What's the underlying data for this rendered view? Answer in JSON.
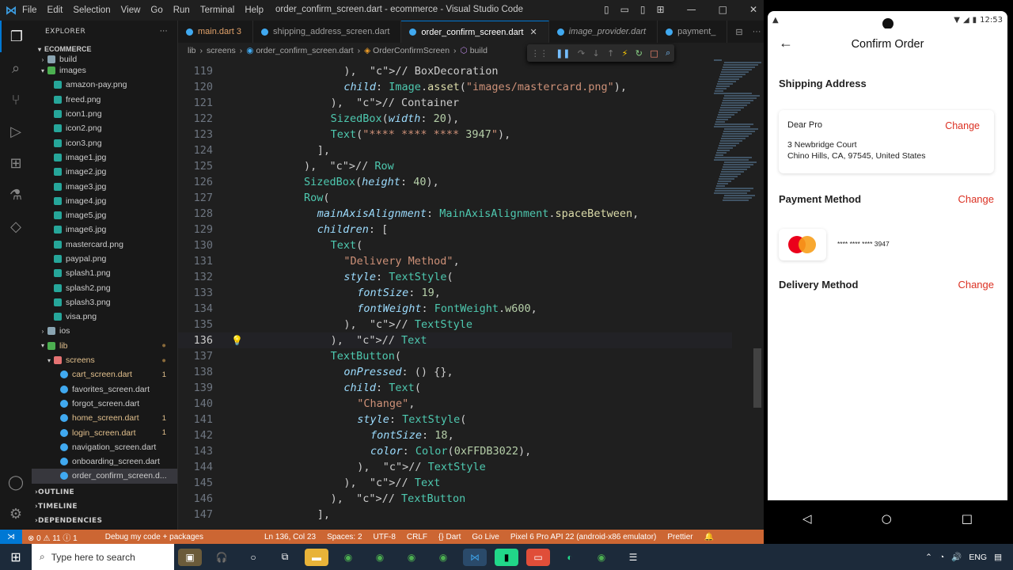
{
  "window": {
    "title": "order_confirm_screen.dart - ecommerce - Visual Studio Code",
    "menu": [
      "File",
      "Edit",
      "Selection",
      "View",
      "Go",
      "Run",
      "Terminal",
      "Help"
    ]
  },
  "sidebar": {
    "header": "EXPLORER",
    "project": "ECOMMERCE",
    "items": [
      {
        "label": "build",
        "type": "folder",
        "depth": 1
      },
      {
        "label": "images",
        "type": "folder-open",
        "depth": 1
      },
      {
        "label": "amazon-pay.png",
        "type": "img",
        "depth": 2
      },
      {
        "label": "freed.png",
        "type": "img",
        "depth": 2
      },
      {
        "label": "icon1.png",
        "type": "img",
        "depth": 2
      },
      {
        "label": "icon2.png",
        "type": "img",
        "depth": 2
      },
      {
        "label": "icon3.png",
        "type": "img",
        "depth": 2
      },
      {
        "label": "image1.jpg",
        "type": "img",
        "depth": 2
      },
      {
        "label": "image2.jpg",
        "type": "img",
        "depth": 2
      },
      {
        "label": "image3.jpg",
        "type": "img",
        "depth": 2
      },
      {
        "label": "image4.jpg",
        "type": "img",
        "depth": 2
      },
      {
        "label": "image5.jpg",
        "type": "img",
        "depth": 2
      },
      {
        "label": "image6.jpg",
        "type": "img",
        "depth": 2
      },
      {
        "label": "mastercard.png",
        "type": "img",
        "depth": 2
      },
      {
        "label": "paypal.png",
        "type": "img",
        "depth": 2
      },
      {
        "label": "splash1.png",
        "type": "img",
        "depth": 2
      },
      {
        "label": "splash2.png",
        "type": "img",
        "depth": 2
      },
      {
        "label": "splash3.png",
        "type": "img",
        "depth": 2
      },
      {
        "label": "visa.png",
        "type": "img",
        "depth": 2
      },
      {
        "label": "ios",
        "type": "folder",
        "depth": 1
      },
      {
        "label": "lib",
        "type": "folder-lib",
        "depth": 1,
        "badge": "●"
      },
      {
        "label": "screens",
        "type": "folder-screens",
        "depth": 2,
        "badge": "●"
      },
      {
        "label": "cart_screen.dart",
        "type": "dart",
        "depth": 3,
        "badge": "1",
        "warn": true
      },
      {
        "label": "favorites_screen.dart",
        "type": "dart",
        "depth": 3
      },
      {
        "label": "forgot_screen.dart",
        "type": "dart",
        "depth": 3
      },
      {
        "label": "home_screen.dart",
        "type": "dart",
        "depth": 3,
        "badge": "1",
        "warn": true
      },
      {
        "label": "login_screen.dart",
        "type": "dart",
        "depth": 3,
        "badge": "1",
        "warn": true
      },
      {
        "label": "navigation_screen.dart",
        "type": "dart",
        "depth": 3
      },
      {
        "label": "onboarding_screen.dart",
        "type": "dart",
        "depth": 3
      },
      {
        "label": "order_confirm_screen.d...",
        "type": "dart",
        "depth": 3,
        "selected": true
      }
    ],
    "sections": [
      "OUTLINE",
      "TIMELINE",
      "DEPENDENCIES"
    ]
  },
  "tabs": [
    {
      "label": "main.dart",
      "badge": "3"
    },
    {
      "label": "shipping_address_screen.dart"
    },
    {
      "label": "order_confirm_screen.dart",
      "active": true
    },
    {
      "label": "image_provider.dart",
      "italic": true
    },
    {
      "label": "payment_"
    }
  ],
  "breadcrumb": [
    "lib",
    "screens",
    "order_confirm_screen.dart",
    "OrderConfirmScreen",
    "build"
  ],
  "editor": {
    "current_line": 136,
    "lines": [
      {
        "n": "119",
        "code": "),  // BoxDecoration"
      },
      {
        "n": "120",
        "code": "child: Image.asset(\"images/mastercard.png\"),"
      },
      {
        "n": "121",
        "code": "),  // Container"
      },
      {
        "n": "122",
        "code": "SizedBox(width: 20),"
      },
      {
        "n": "123",
        "code": "Text(\"**** **** **** 3947\"),"
      },
      {
        "n": "124",
        "code": "],"
      },
      {
        "n": "125",
        "code": "),  // Row"
      },
      {
        "n": "126",
        "code": "SizedBox(height: 40),"
      },
      {
        "n": "127",
        "code": "Row("
      },
      {
        "n": "128",
        "code": "mainAxisAlignment: MainAxisAlignment.spaceBetween,"
      },
      {
        "n": "129",
        "code": "children: ["
      },
      {
        "n": "130",
        "code": "Text("
      },
      {
        "n": "131",
        "code": "\"Delivery Method\","
      },
      {
        "n": "132",
        "code": "style: TextStyle("
      },
      {
        "n": "133",
        "code": "fontSize: 19,"
      },
      {
        "n": "134",
        "code": "fontWeight: FontWeight.w600,"
      },
      {
        "n": "135",
        "code": "),  // TextStyle"
      },
      {
        "n": "136",
        "code": "),  // Text"
      },
      {
        "n": "137",
        "code": "TextButton("
      },
      {
        "n": "138",
        "code": "onPressed: () {},"
      },
      {
        "n": "139",
        "code": "child: Text("
      },
      {
        "n": "140",
        "code": "\"Change\","
      },
      {
        "n": "141",
        "code": "style: TextStyle("
      },
      {
        "n": "142",
        "code": "fontSize: 18,"
      },
      {
        "n": "143",
        "code": "color: Color(0xFFDB3022),"
      },
      {
        "n": "144",
        "code": "),  // TextStyle"
      },
      {
        "n": "145",
        "code": "),  // Text"
      },
      {
        "n": "146",
        "code": "),  // TextButton"
      },
      {
        "n": "147",
        "code": "],"
      }
    ]
  },
  "statusbar": {
    "errors": "⊗ 0 ⚠ 11 ⓘ 1",
    "debug": "Debug my code + packages",
    "position": "Ln 136, Col 23",
    "spaces": "Spaces: 2",
    "encoding": "UTF-8",
    "eol": "CRLF",
    "language": "{} Dart",
    "golive": "Go Live",
    "device": "Pixel 6 Pro API 22 (android-x86 emulator)",
    "prettier": "Prettier"
  },
  "phone": {
    "time": "12:53",
    "title": "Confirm Order",
    "shipping_title": "Shipping Address",
    "addr_name": "Dear Pro",
    "addr_change": "Change",
    "addr_line1": "3 Newbridge Court",
    "addr_line2": "Chino Hills, CA, 97545, United States",
    "payment_title": "Payment Method",
    "payment_change": "Change",
    "card_number": "**** **** **** 3947",
    "delivery_title": "Delivery Method",
    "delivery_change": "Change",
    "accent": "#DB3022"
  },
  "taskbar": {
    "search_placeholder": "Type here to search",
    "lang": "ENG"
  }
}
